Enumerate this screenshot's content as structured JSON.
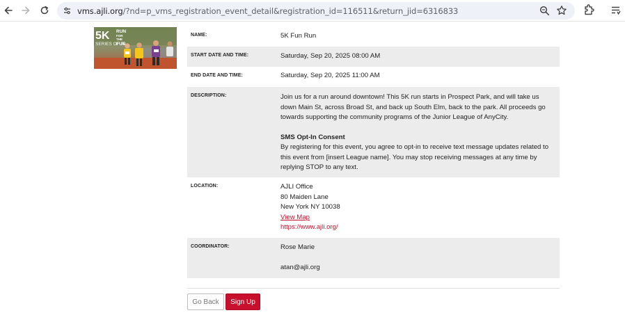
{
  "browser": {
    "url_host": "vms.ajli.org",
    "url_rest": "/?nd=p_vms_registration_event_detail&registration_id=116511&return_jid=6316833"
  },
  "event_image": {
    "text_big": "5K",
    "text_run": "RUN",
    "text_for": "FOR",
    "text_the": "THE",
    "text_fun": "FUN",
    "text_series": "SERIES OF IT"
  },
  "details": {
    "name_label": "NAME:",
    "name_value": "5K Fun Run",
    "start_label": "START DATE AND TIME:",
    "start_value": "Saturday, Sep 20, 2025 08:00 AM",
    "end_label": "END DATE AND TIME:",
    "end_value": "Saturday, Sep 20, 2025 11:00 AM",
    "description_label": "DESCRIPTION:",
    "description_text": "Join us for a run around downtown!  This 5K run starts in Prospect Park, and will take us down Main St, across Broad St, and back up South Elm, back to the park.  All proceeds go towards supporting the community programs of the Junior League of AnyCity.",
    "sms_heading": "SMS Opt-In Consent",
    "sms_text": "By registering for this event, you agree to opt-in to receive text message updates related to this event from [insert League name]. You may stop receiving messages at any time by replying STOP to any text.",
    "location_label": "LOCATION:",
    "location_line1": "AJLI Office",
    "location_line2": "80 Maiden Lane",
    "location_line3": "New York NY 10038",
    "location_map_link": "View Map",
    "location_website": "https://www.ajli.org/",
    "coordinator_label": "COORDINATOR:",
    "coordinator_name": "Rose Marie",
    "coordinator_email": "atan@ajli.org"
  },
  "actions": {
    "go_back": "Go Back",
    "sign_up": "Sign Up"
  },
  "colors": {
    "accent": "#c8102e",
    "row_shade": "#ececec"
  }
}
